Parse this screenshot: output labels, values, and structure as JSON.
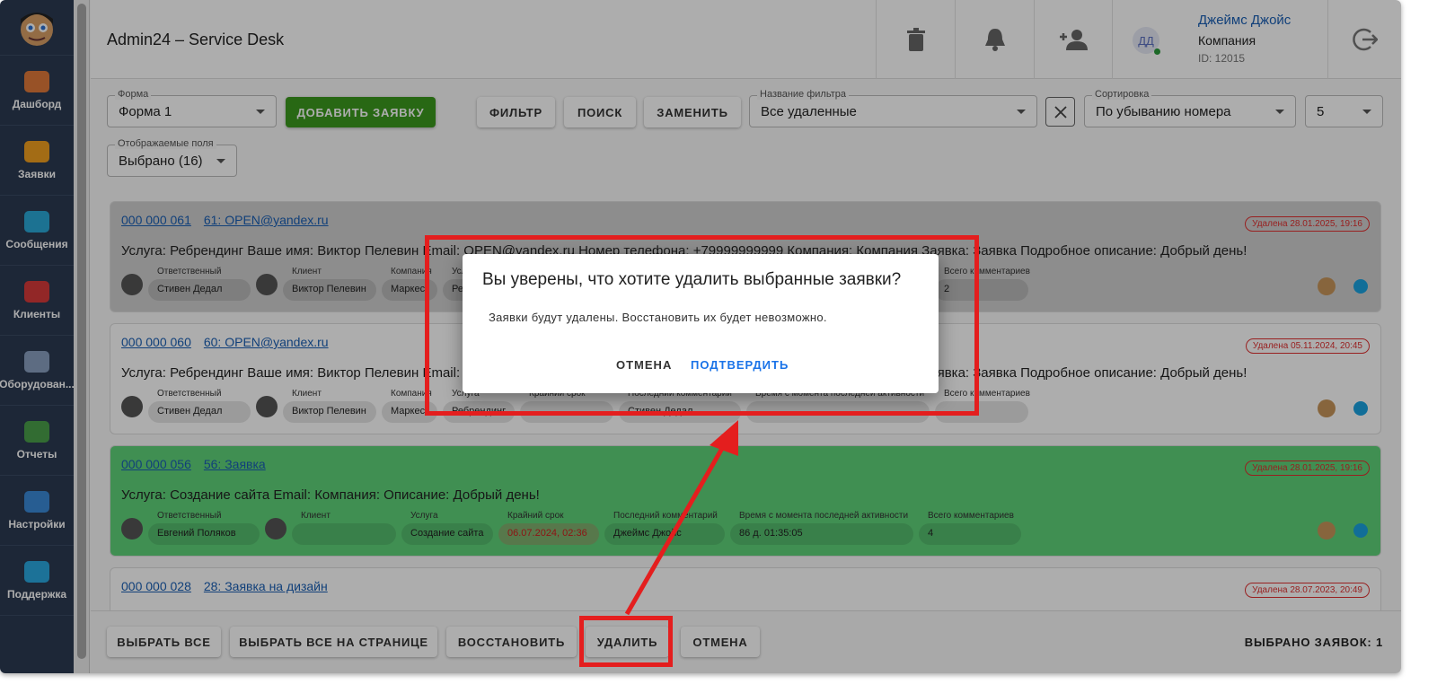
{
  "sidebar": {
    "items": [
      {
        "label": "Дашборд",
        "color": "#e07a3a"
      },
      {
        "label": "Заявки",
        "color": "#f0a020"
      },
      {
        "label": "Сообщения",
        "color": "#2aa8d8"
      },
      {
        "label": "Клиенты",
        "color": "#d83a3a"
      },
      {
        "label": "Оборудован...",
        "color": "#8aa0c0"
      },
      {
        "label": "Отчеты",
        "color": "#4aa04a"
      },
      {
        "label": "Настройки",
        "color": "#3a8ad8"
      },
      {
        "label": "Поддержка",
        "color": "#2aa8e0"
      }
    ]
  },
  "header": {
    "title": "Admin24 – Service Desk",
    "user_name": "Джеймс Джойс",
    "company": "Компания",
    "user_id": "ID: 12015",
    "initials": "ДД"
  },
  "toolbar": {
    "form_label": "Форма",
    "form_value": "Форма 1",
    "add_label": "ДОБАВИТЬ ЗАЯВКУ",
    "filter_label": "ФИЛЬТР",
    "search_label": "ПОИСК",
    "replace_label": "ЗАМЕНИТЬ",
    "filter_name_label": "Название фильтра",
    "filter_name_value": "Все удаленные",
    "sort_label": "Сортировка",
    "sort_value": "По убыванию номера",
    "page_size": "5",
    "fields_label": "Отображаемые поля",
    "fields_value": "Выбрано (16)"
  },
  "cards": [
    {
      "number": "000 000 061",
      "subject": "61: OPEN@yandex.ru",
      "desc": "Услуга: Ребрендинг Ваше имя: Виктор Пелевин Email: OPEN@yandex.ru Номер телефона: +79999999999 Компания: Компания Заявка: Заявка Подробное описание: Добрый день!",
      "deleted": "Удалена 28.01.2025, 19:16",
      "fields": [
        {
          "label": "Ответственный",
          "value": "Стивен Дедал"
        },
        {
          "label": "Клиент",
          "value": "Виктор Пелевин"
        },
        {
          "label": "Компания",
          "value": "Маркес"
        },
        {
          "label": "Услуга",
          "value": "Ребрендинг"
        },
        {
          "label": "Крайний срок",
          "value": ""
        },
        {
          "label": "Последний комментарий",
          "value": ""
        },
        {
          "label": "Время с момента последней активности",
          "value": ""
        },
        {
          "label": "Всего комментариев",
          "value": "2"
        }
      ]
    },
    {
      "number": "000 000 060",
      "subject": "60: OPEN@yandex.ru",
      "desc": "Услуга: Ребрендинг Ваше имя: Виктор Пелевин Email: OPEN@yandex.ru Номер телефона: +79999999999 Компания: Компания Заявка: Заявка Подробное описание: Добрый день!",
      "deleted": "Удалена 05.11.2024, 20:45",
      "fields": [
        {
          "label": "Ответственный",
          "value": "Стивен Дедал"
        },
        {
          "label": "Клиент",
          "value": "Виктор Пелевин"
        },
        {
          "label": "Компания",
          "value": "Маркес"
        },
        {
          "label": "Услуга",
          "value": "Ребрендинг"
        },
        {
          "label": "Крайний срок",
          "value": ""
        },
        {
          "label": "Последний комментарий",
          "value": "Стивен Дедал"
        },
        {
          "label": "Время с момента последней активности",
          "value": ""
        },
        {
          "label": "Всего комментариев",
          "value": ""
        }
      ]
    },
    {
      "number": "000 000 056",
      "subject": "56: Заявка",
      "desc": "Услуга: Создание сайта Email:                                                          Компания: Описание: Добрый день!",
      "deleted": "Удалена 28.01.2025, 19:16",
      "fields": [
        {
          "label": "Ответственный",
          "value": "Евгений Поляков"
        },
        {
          "label": "Клиент",
          "value": ""
        },
        {
          "label": "Услуга",
          "value": "Создание сайта"
        },
        {
          "label": "Крайний срок",
          "value": "06.07.2024, 02:36"
        },
        {
          "label": "Последний комментарий",
          "value": "Джеймс Джойс"
        },
        {
          "label": "Время с момента последней активности",
          "value": "86 д. 01:35:05"
        },
        {
          "label": "Всего комментариев",
          "value": "4"
        }
      ]
    },
    {
      "number": "000 000 028",
      "subject": "28: Заявка на дизайн",
      "desc": "",
      "deleted": "Удалена 28.07.2023, 20:49",
      "fields": []
    }
  ],
  "footer": {
    "select_all": "ВЫБРАТЬ ВСЕ",
    "select_page": "ВЫБРАТЬ ВСЕ НА СТРАНИЦЕ",
    "restore": "ВОССТАНОВИТЬ",
    "delete": "УДАЛИТЬ",
    "cancel": "ОТМЕНА",
    "selected_count": "ВЫБРАНО ЗАЯВОК: 1"
  },
  "dialog": {
    "title": "Вы уверены, что хотите удалить выбранные заявки?",
    "text": "Заявки будут удалены. Восстановить их будет невозможно.",
    "cancel": "ОТМЕНА",
    "confirm": "ПОДТВЕРДИТЬ"
  },
  "colors": {
    "accent": "#1a73e8",
    "add_button": "#3c9a1e",
    "annotation": "#e41e1e",
    "selected_card": "#5fd37a"
  }
}
